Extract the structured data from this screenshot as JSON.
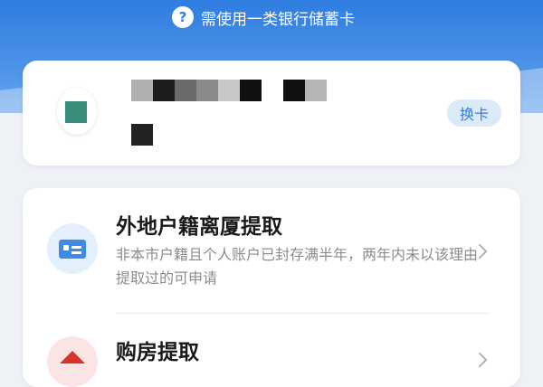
{
  "header": {
    "hint_text": "需使用一类银行储蓄卡",
    "hint_icon": "question-circle-icon",
    "bg_color": "#2f7de0"
  },
  "bank_card": {
    "logo_icon": "bank-logo-icon",
    "logo_color": "#3a8f7c",
    "switch_label": "换卡"
  },
  "options": [
    {
      "icon": "id-card-icon",
      "title": "外地户籍离厦提取",
      "description": "非本市户籍且个人账户已封存满半年，两年内未以该理由提取过的可申请"
    },
    {
      "icon": "house-icon",
      "title": "购房提取"
    }
  ]
}
